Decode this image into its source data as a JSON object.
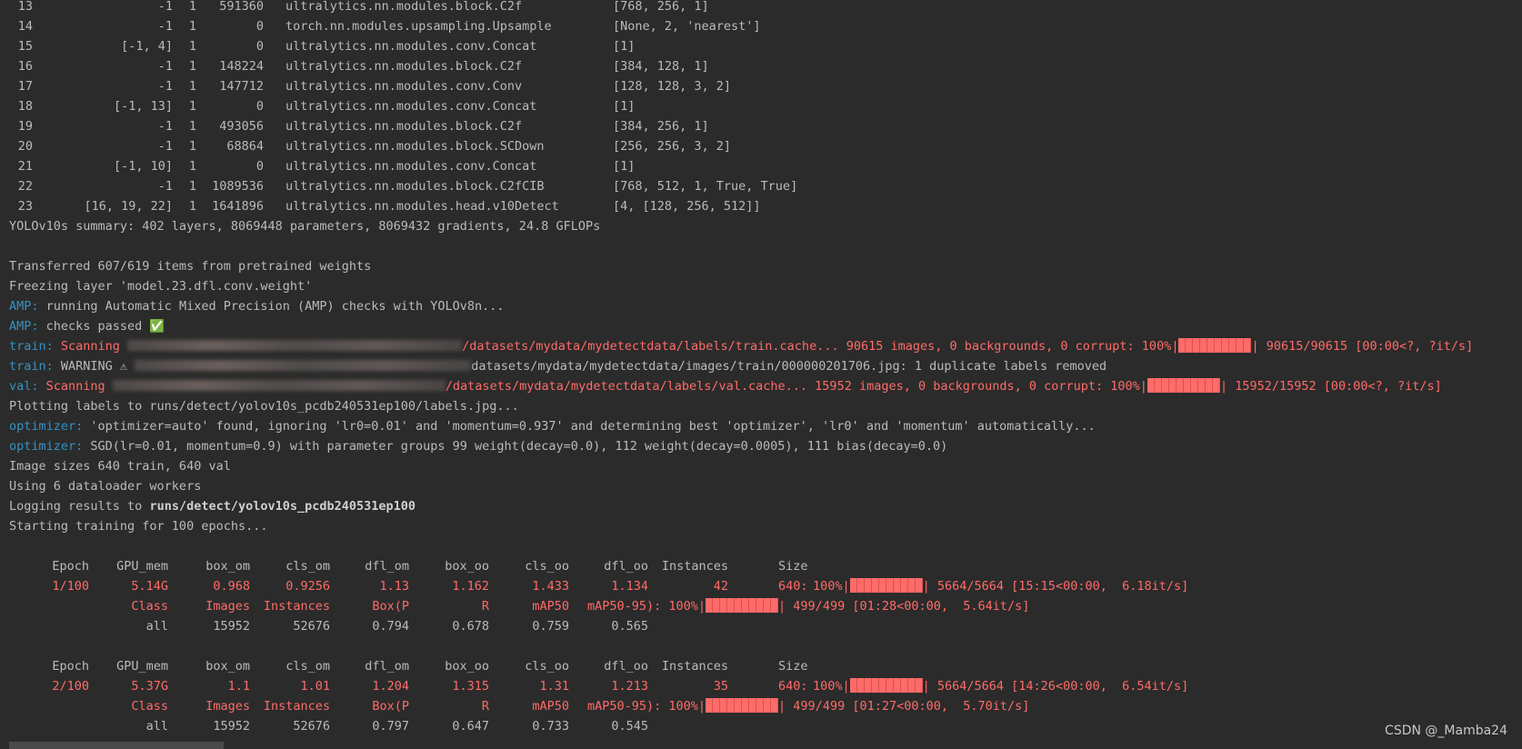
{
  "model_table": [
    {
      "idx": "13",
      "from": "-1",
      "n": "1",
      "params": "591360",
      "module": "ultralytics.nn.modules.block.C2f",
      "args": "[768, 256, 1]"
    },
    {
      "idx": "14",
      "from": "-1",
      "n": "1",
      "params": "0",
      "module": "torch.nn.modules.upsampling.Upsample",
      "args": "[None, 2, 'nearest']"
    },
    {
      "idx": "15",
      "from": "[-1, 4]",
      "n": "1",
      "params": "0",
      "module": "ultralytics.nn.modules.conv.Concat",
      "args": "[1]"
    },
    {
      "idx": "16",
      "from": "-1",
      "n": "1",
      "params": "148224",
      "module": "ultralytics.nn.modules.block.C2f",
      "args": "[384, 128, 1]"
    },
    {
      "idx": "17",
      "from": "-1",
      "n": "1",
      "params": "147712",
      "module": "ultralytics.nn.modules.conv.Conv",
      "args": "[128, 128, 3, 2]"
    },
    {
      "idx": "18",
      "from": "[-1, 13]",
      "n": "1",
      "params": "0",
      "module": "ultralytics.nn.modules.conv.Concat",
      "args": "[1]"
    },
    {
      "idx": "19",
      "from": "-1",
      "n": "1",
      "params": "493056",
      "module": "ultralytics.nn.modules.block.C2f",
      "args": "[384, 256, 1]"
    },
    {
      "idx": "20",
      "from": "-1",
      "n": "1",
      "params": "68864",
      "module": "ultralytics.nn.modules.block.SCDown",
      "args": "[256, 256, 3, 2]"
    },
    {
      "idx": "21",
      "from": "[-1, 10]",
      "n": "1",
      "params": "0",
      "module": "ultralytics.nn.modules.conv.Concat",
      "args": "[1]"
    },
    {
      "idx": "22",
      "from": "-1",
      "n": "1",
      "params": "1089536",
      "module": "ultralytics.nn.modules.block.C2fCIB",
      "args": "[768, 512, 1, True, True]"
    },
    {
      "idx": "23",
      "from": "[16, 19, 22]",
      "n": "1",
      "params": "1641896",
      "module": "ultralytics.nn.modules.head.v10Detect",
      "args": "[4, [128, 256, 512]]"
    }
  ],
  "summary": "YOLOv10s summary: 402 layers, 8069448 parameters, 8069432 gradients, 24.8 GFLOPs",
  "log": {
    "transferred": "Transferred 607/619 items from pretrained weights",
    "freezing": "Freezing layer 'model.23.dfl.conv.weight'",
    "amp1_tag": "AMP:",
    "amp1_text": " running Automatic Mixed Precision (AMP) checks with YOLOv8n...",
    "amp2_tag": "AMP:",
    "amp2_text": " checks passed ✅",
    "train1_tag": "train:",
    "train1_a": " Scanning ",
    "train1_b": "/datasets/mydata/mydetectdata/labels/train.cache... 90615 images, 0 backgrounds, 0 corrupt: 100%|",
    "train1_c": "| 90615/90615 [00:00<?, ?it/s]",
    "train2_tag": "train:",
    "train2_a": " WARNING ⚠ ",
    "train2_b": "datasets/mydata/mydetectdata/images/train/000000201706.jpg: 1 duplicate labels removed",
    "val_tag": "val:",
    "val_a": " Scanning ",
    "val_b": "/datasets/mydata/mydetectdata/labels/val.cache... 15952 images, 0 backgrounds, 0 corrupt: 100%|",
    "val_c": "| 15952/15952 [00:00<?, ?it/s]",
    "plotting": "Plotting labels to runs/detect/yolov10s_pcdb240531ep100/labels.jpg...",
    "opt1_tag": "optimizer:",
    "opt1_text": " 'optimizer=auto' found, ignoring 'lr0=0.01' and 'momentum=0.937' and determining best 'optimizer', 'lr0' and 'momentum' automatically...",
    "opt2_tag": "optimizer:",
    "opt2_text": " SGD(lr=0.01, momentum=0.9) with parameter groups 99 weight(decay=0.0), 112 weight(decay=0.0005), 111 bias(decay=0.0)",
    "imgsize": "Image sizes 640 train, 640 val",
    "workers": "Using 6 dataloader workers",
    "logging_a": "Logging results to ",
    "logging_b": "runs/detect/yolov10s_pcdb240531ep100",
    "starting": "Starting training for 100 epochs..."
  },
  "epoch_header": [
    "Epoch",
    "GPU_mem",
    "box_om",
    "cls_om",
    "dfl_om",
    "box_oo",
    "cls_oo",
    "dfl_oo",
    "Instances",
    "Size"
  ],
  "epochs": [
    {
      "row": [
        "1/100",
        "5.14G",
        "0.968",
        "0.9256",
        "1.13",
        "1.162",
        "1.433",
        "1.134",
        "42",
        "640:"
      ],
      "progress": "100%|",
      "progress_tail": "| 5664/5664 [15:15<00:00,  6.18it/s]",
      "progress_pct": 100,
      "val_header": [
        "Class",
        "Images",
        "Instances",
        "Box(P",
        "R",
        "mAP50"
      ],
      "val_header_tail": "mAP50-95): 100%|",
      "val_progress_tail": "| 499/499 [01:28<00:00,  5.64it/s]",
      "val_row": [
        "all",
        "15952",
        "52676",
        "0.794",
        "0.678",
        "0.759",
        "0.565"
      ]
    },
    {
      "row": [
        "2/100",
        "5.37G",
        "1.1",
        "1.01",
        "1.204",
        "1.315",
        "1.31",
        "1.213",
        "35",
        "640:"
      ],
      "progress": "100%|",
      "progress_tail": "| 5664/5664 [14:26<00:00,  6.54it/s]",
      "progress_pct": 100,
      "val_header": [
        "Class",
        "Images",
        "Instances",
        "Box(P",
        "R",
        "mAP50"
      ],
      "val_header_tail": "mAP50-95): 100%|",
      "val_progress_tail": "| 499/499 [01:27<00:00,  5.70it/s]",
      "val_row": [
        "all",
        "15952",
        "52676",
        "0.797",
        "0.647",
        "0.733",
        "0.545"
      ]
    }
  ],
  "watermark": "CSDN @_Mamba24",
  "colors": {
    "background": "#2b2b2b",
    "text": "#bbbbbb",
    "tag_blue": "#3592c4",
    "error_red": "#ff6b68"
  }
}
